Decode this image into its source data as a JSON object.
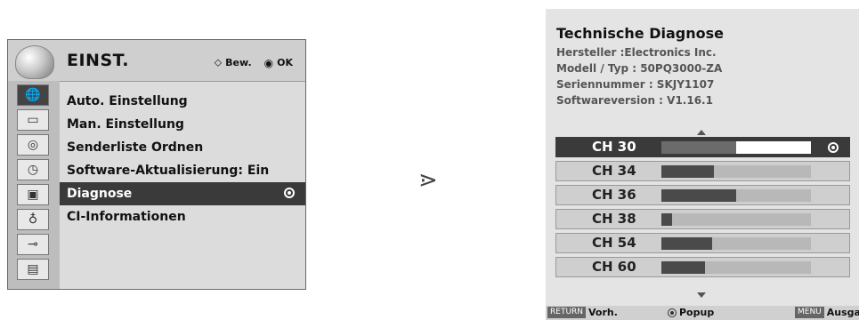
{
  "menu": {
    "title": "EINST.",
    "hint_move_label": "Bew.",
    "hint_ok_label": "OK",
    "side_icons": [
      "globe-icon",
      "tv-icon",
      "speaker-icon",
      "clock-icon",
      "lock-icon",
      "key-icon",
      "plug-icon",
      "film-icon"
    ],
    "active_side_icon_index": 0,
    "items": [
      {
        "label": "Auto. Einstellung"
      },
      {
        "label": "Man. Einstellung"
      },
      {
        "label": "Senderliste Ordnen"
      },
      {
        "label": "Software-Aktualisierung: Ein"
      },
      {
        "label": "Diagnose"
      },
      {
        "label": "CI-Informationen"
      }
    ],
    "selected_item_index": 4
  },
  "diagnose": {
    "title": "Technische Diagnose",
    "manufacturer": "Hersteller :Electronics Inc.",
    "model": "Modell / Typ : 50PQ3000-ZA",
    "serial": "Seriennummer : SKJY1107",
    "software": "Softwareversion : V1.16.1",
    "channels": [
      {
        "label": "CH 30",
        "level": 0.5
      },
      {
        "label": "CH 34",
        "level": 0.35
      },
      {
        "label": "CH 36",
        "level": 0.5
      },
      {
        "label": "CH 38",
        "level": 0.07
      },
      {
        "label": "CH 54",
        "level": 0.34
      },
      {
        "label": "CH 60",
        "level": 0.29
      }
    ],
    "selected_channel_index": 0
  },
  "footer": {
    "return_key": "RETURN",
    "return_label": "Vorh.",
    "popup_label": "Popup",
    "menu_key": "MENU",
    "menu_label": "Ausgang"
  },
  "arrow_glyph": "⋗"
}
